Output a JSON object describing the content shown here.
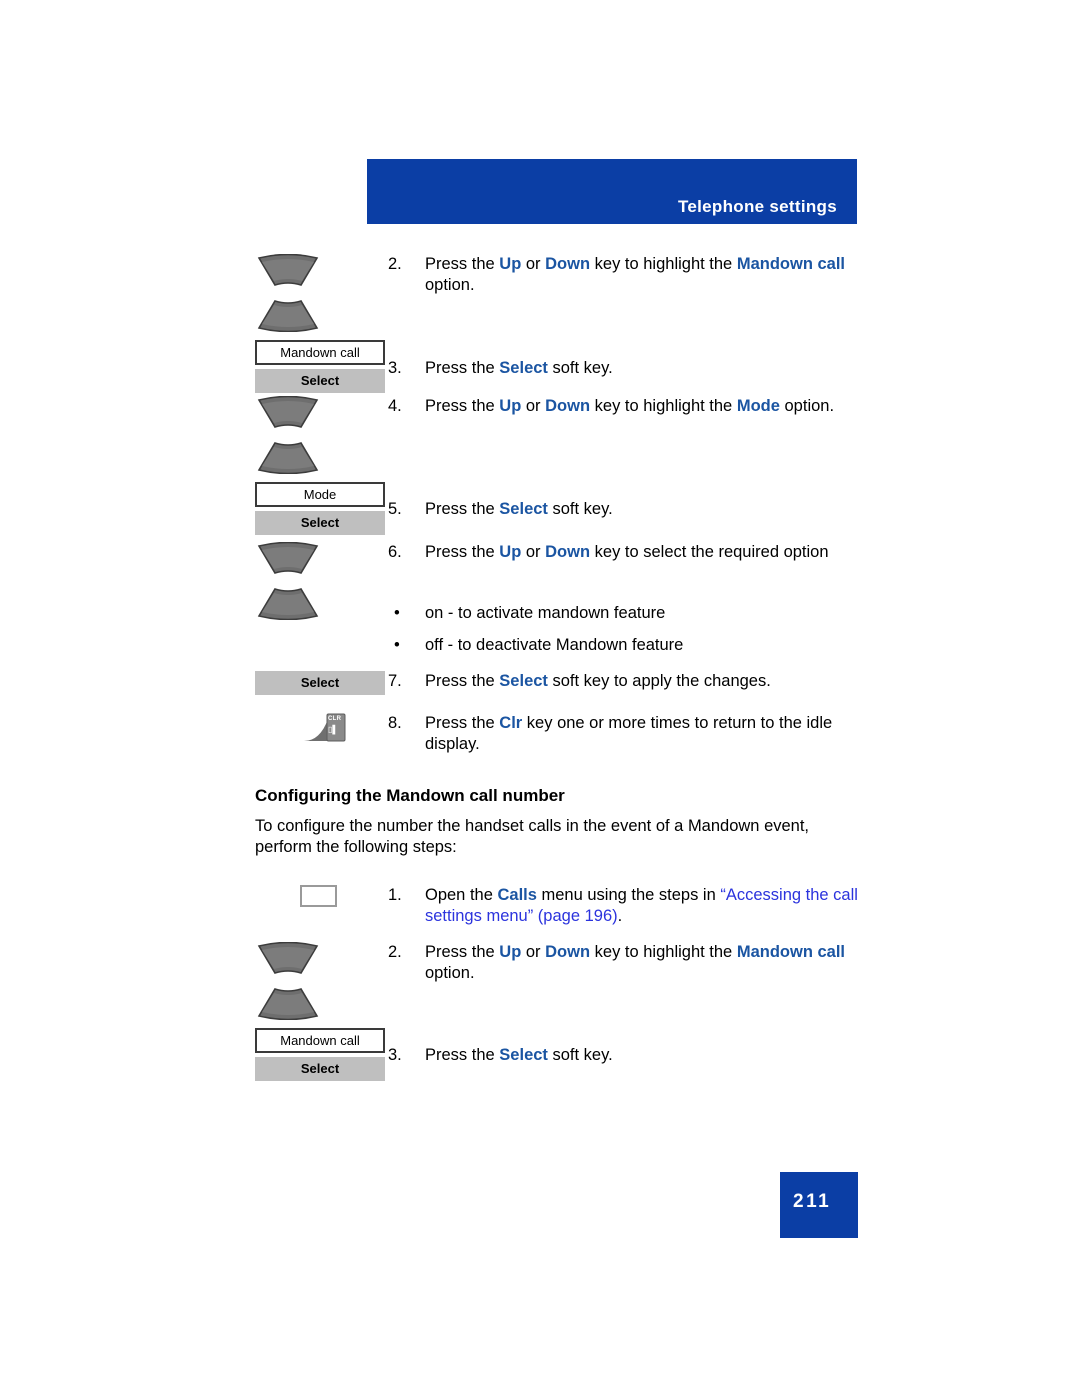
{
  "header": {
    "title": "Telephone settings"
  },
  "colors": {
    "banner_blue": "#0B3EA5",
    "keyword_blue": "#1B55A2",
    "xref_blue": "#2B33DD",
    "softkey_gray": "#BFBFBF"
  },
  "procedure_one": {
    "steps": [
      {
        "number": "2.",
        "icon": "nav-up-down-key",
        "display_label": "Mandown call",
        "softkey_label": "Select",
        "text_segments": [
          {
            "text": "Press the ",
            "style": "plain"
          },
          {
            "text": "Up",
            "style": "keyword"
          },
          {
            "text": " or ",
            "style": "plain"
          },
          {
            "text": "Down",
            "style": "keyword"
          },
          {
            "text": " key to highlight the ",
            "style": "plain"
          },
          {
            "text": "Mandown call",
            "style": "keyword"
          },
          {
            "text": " option.",
            "style": "plain"
          }
        ]
      },
      {
        "number": "3.",
        "text_segments": [
          {
            "text": "Press the ",
            "style": "plain"
          },
          {
            "text": "Select",
            "style": "keyword"
          },
          {
            "text": " soft key.",
            "style": "plain"
          }
        ]
      },
      {
        "number": "4.",
        "icon": "nav-up-down-key",
        "display_label": "Mode",
        "softkey_label": "Select",
        "text_segments": [
          {
            "text": "Press the ",
            "style": "plain"
          },
          {
            "text": "Up",
            "style": "keyword"
          },
          {
            "text": " or ",
            "style": "plain"
          },
          {
            "text": "Down",
            "style": "keyword"
          },
          {
            "text": " key to highlight the ",
            "style": "plain"
          },
          {
            "text": "Mode",
            "style": "keyword"
          },
          {
            "text": " option.",
            "style": "plain"
          }
        ]
      },
      {
        "number": "5.",
        "text_segments": [
          {
            "text": "Press the ",
            "style": "plain"
          },
          {
            "text": "Select",
            "style": "keyword"
          },
          {
            "text": " soft key.",
            "style": "plain"
          }
        ]
      },
      {
        "number": "6.",
        "icon": "nav-up-down-key",
        "text_segments": [
          {
            "text": "Press the ",
            "style": "plain"
          },
          {
            "text": "Up",
            "style": "keyword"
          },
          {
            "text": " or ",
            "style": "plain"
          },
          {
            "text": "Down",
            "style": "keyword"
          },
          {
            "text": " key to select the required option",
            "style": "plain"
          }
        ],
        "bullets": [
          "on - to activate mandown feature",
          "off - to deactivate Mandown feature"
        ]
      },
      {
        "number": "7.",
        "icon": "softkey",
        "softkey_label": "Select",
        "text_segments": [
          {
            "text": "Press the ",
            "style": "plain"
          },
          {
            "text": "Select",
            "style": "keyword"
          },
          {
            "text": " soft key to apply the changes.",
            "style": "plain"
          }
        ]
      },
      {
        "number": "8.",
        "icon": "clr-key",
        "clr_label": "CLR",
        "text_segments": [
          {
            "text": "Press the ",
            "style": "plain"
          },
          {
            "text": "Clr",
            "style": "keyword"
          },
          {
            "text": " key one or more times to return to the idle display.",
            "style": "plain"
          }
        ]
      }
    ]
  },
  "section": {
    "heading": "Configuring the Mandown call number",
    "paragraph": "To configure the number the handset calls in the event of a Mandown event, perform the following steps:"
  },
  "procedure_two": {
    "steps": [
      {
        "number": "1.",
        "icon": "blank-key",
        "text_segments": [
          {
            "text": "Open the ",
            "style": "plain"
          },
          {
            "text": "Calls",
            "style": "keyword"
          },
          {
            "text": " menu using the steps in ",
            "style": "plain"
          },
          {
            "text": "“Accessing the call settings menu” (page 196)",
            "style": "xref"
          },
          {
            "text": ".",
            "style": "plain"
          }
        ]
      },
      {
        "number": "2.",
        "icon": "nav-up-down-key",
        "display_label": "Mandown call",
        "softkey_label": "Select",
        "text_segments": [
          {
            "text": "Press the ",
            "style": "plain"
          },
          {
            "text": "Up",
            "style": "keyword"
          },
          {
            "text": " or ",
            "style": "plain"
          },
          {
            "text": "Down",
            "style": "keyword"
          },
          {
            "text": " key to highlight the ",
            "style": "plain"
          },
          {
            "text": "Mandown call",
            "style": "keyword"
          },
          {
            "text": " option.",
            "style": "plain"
          }
        ]
      },
      {
        "number": "3.",
        "text_segments": [
          {
            "text": "Press the ",
            "style": "plain"
          },
          {
            "text": "Select",
            "style": "keyword"
          },
          {
            "text": " soft key.",
            "style": "plain"
          }
        ]
      }
    ]
  },
  "footer": {
    "page_number": "211"
  }
}
